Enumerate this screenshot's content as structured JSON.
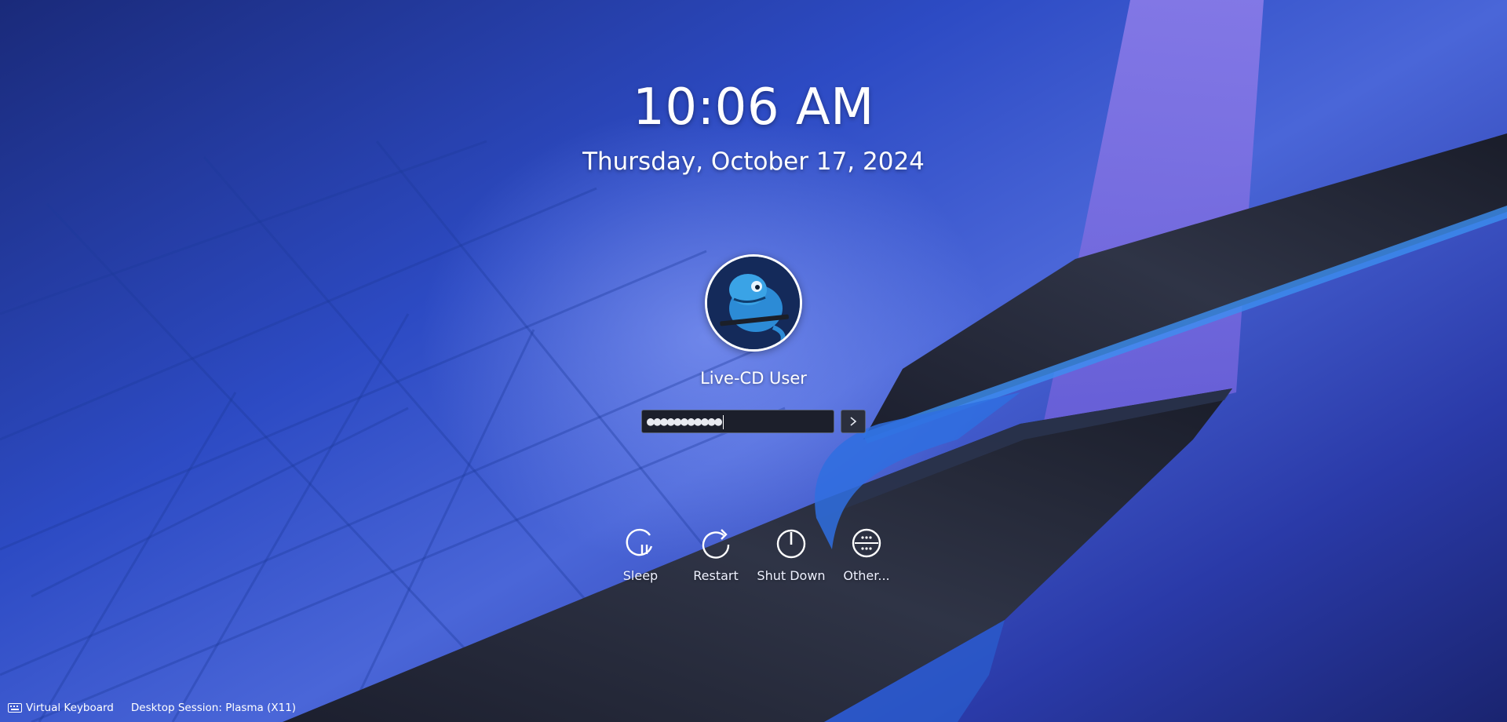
{
  "clock": {
    "time": "10:06 AM",
    "date": "Thursday, October 17, 2024"
  },
  "user": {
    "name": "Live-CD User",
    "avatar_icon": "chameleon-mascot-icon"
  },
  "login": {
    "password_value": "●●●●●●●●●●●",
    "submit_icon": "chevron-right-icon"
  },
  "actions": [
    {
      "label": "Sleep",
      "icon": "sleep-icon"
    },
    {
      "label": "Restart",
      "icon": "restart-icon"
    },
    {
      "label": "Shut Down",
      "icon": "power-icon"
    },
    {
      "label": "Other...",
      "icon": "other-icon"
    }
  ],
  "bottom_bar": {
    "virtual_keyboard": "Virtual Keyboard",
    "session": "Desktop Session: Plasma (X11)"
  },
  "colors": {
    "accent": "#3daee9",
    "field_bg": "#1c1f2b",
    "background": "#2d4bc4"
  }
}
